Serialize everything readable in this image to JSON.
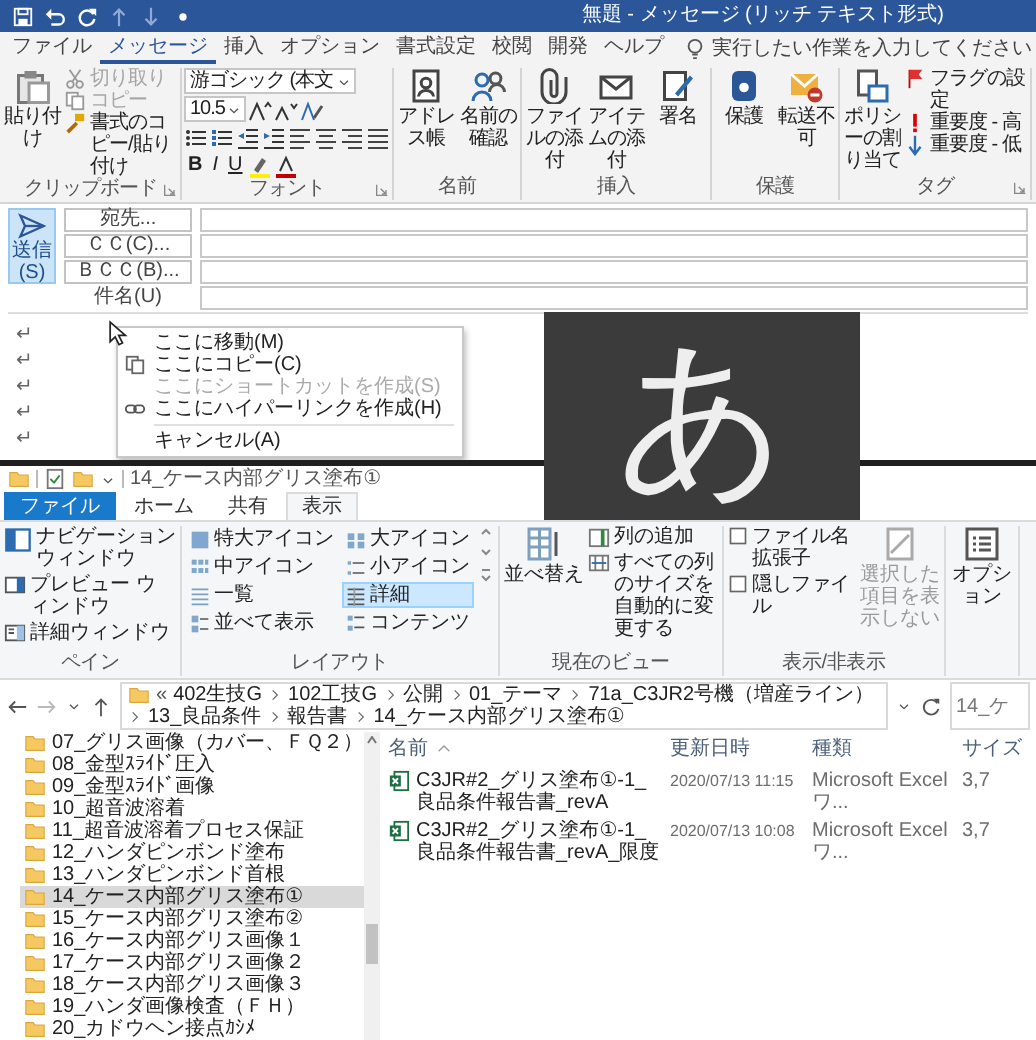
{
  "outlook": {
    "title": "無題 - メッセージ (リッチ テキスト形式)",
    "tabs": [
      {
        "label": "ファイル",
        "selected": false
      },
      {
        "label": "メッセージ",
        "selected": true
      },
      {
        "label": "挿入",
        "selected": false
      },
      {
        "label": "オプション",
        "selected": false
      },
      {
        "label": "書式設定",
        "selected": false
      },
      {
        "label": "校閲",
        "selected": false
      },
      {
        "label": "開発",
        "selected": false
      },
      {
        "label": "ヘルプ",
        "selected": false
      }
    ],
    "tell_me": {
      "placeholder": "実行したい作業を入力してください"
    },
    "ribbon_groups": [
      {
        "kind": "buttons",
        "label": "クリップボード",
        "launcher": true,
        "large": [
          {
            "label": "貼り付け",
            "disabled": false
          }
        ],
        "small": [
          {
            "label": "切り取り",
            "disabled": true
          },
          {
            "label": "コピー",
            "disabled": true
          },
          {
            "label": "書式のコピー/貼り付け",
            "disabled": false
          }
        ]
      },
      {
        "kind": "font",
        "label": "フォント",
        "launcher": true,
        "font_name": "游ゴシック (本文",
        "font_size": "10.5",
        "format_buttons": [
          "B",
          "I",
          "U"
        ]
      },
      {
        "kind": "buttons",
        "label": "名前",
        "launcher": false,
        "large": [
          {
            "label": "アドレス帳",
            "disabled": false
          },
          {
            "label": "名前の確認",
            "disabled": false
          }
        ]
      },
      {
        "kind": "buttons",
        "label": "挿入",
        "launcher": false,
        "large": [
          {
            "label": "ファイルの添付",
            "disabled": false
          },
          {
            "label": "アイテムの添付",
            "disabled": false
          },
          {
            "label": "署名",
            "disabled": false
          }
        ]
      },
      {
        "kind": "buttons",
        "label": "保護",
        "launcher": false,
        "large": [
          {
            "label": "保護",
            "disabled": false
          },
          {
            "label": "転送不可",
            "disabled": false
          }
        ]
      },
      {
        "kind": "buttons",
        "label": "タグ",
        "launcher": true,
        "large": [
          {
            "label": "ポリシーの割り当て",
            "disabled": false
          }
        ],
        "small": [
          {
            "label": "フラグの設定",
            "disabled": false
          },
          {
            "label": "重要度 - 高",
            "disabled": false
          },
          {
            "label": "重要度 - 低",
            "disabled": false
          }
        ]
      }
    ],
    "header": {
      "send_button": "送信 (S)",
      "recipient_buttons": [
        "宛先...",
        "ＣＣ(C)...",
        "ＢＣＣ(B)..."
      ],
      "subject_label": "件名(U)"
    },
    "body": {
      "paragraph_marks": [
        "↵",
        "↵",
        "↵",
        "↵",
        "↵"
      ]
    },
    "context_menu": [
      {
        "label": "ここに移動(M)",
        "disabled": false
      },
      {
        "label": "ここにコピー(C)",
        "disabled": false
      },
      {
        "label": "ここにショートカットを作成(S)",
        "disabled": true
      },
      {
        "label": "ここにハイパーリンクを作成(H)",
        "disabled": false
      },
      {
        "label": "キャンセル(A)",
        "disabled": false
      }
    ]
  },
  "ime_indicator": {
    "char": "あ"
  },
  "explorer": {
    "title": "14_ケース内部グリス塗布①",
    "tabs": [
      {
        "label": "ファイル",
        "kind": "menu",
        "selected": false
      },
      {
        "label": "ホーム",
        "kind": "tab",
        "selected": false
      },
      {
        "label": "共有",
        "kind": "tab",
        "selected": false
      },
      {
        "label": "表示",
        "kind": "tab",
        "selected": true
      }
    ],
    "ribbon": {
      "pane": {
        "label": "ペイン",
        "items": [
          "ナビゲーションウィンドウ",
          "プレビュー ウィンドウ",
          "詳細ウィンドウ"
        ]
      },
      "layout": {
        "label": "レイアウト",
        "options": [
          {
            "label": "特大アイコン",
            "selected": false
          },
          {
            "label": "大アイコン",
            "selected": false
          },
          {
            "label": "中アイコン",
            "selected": false
          },
          {
            "label": "小アイコン",
            "selected": false
          },
          {
            "label": "一覧",
            "selected": false
          },
          {
            "label": "詳細",
            "selected": true
          },
          {
            "label": "並べて表示",
            "selected": false
          },
          {
            "label": "コンテンツ",
            "selected": false
          }
        ]
      },
      "current_view": {
        "label": "現在のビュー",
        "sort": "並べ替え",
        "items": [
          "列の追加",
          "すべての列のサイズを自動的に変更する"
        ]
      },
      "show_hide": {
        "label": "表示/非表示",
        "checkboxes": [
          {
            "label": "ファイル名拡張子",
            "checked": false
          },
          {
            "label": "隠しファイル",
            "checked": false
          }
        ],
        "hide_selected": {
          "label": "選択した項目を表示しない",
          "disabled": true
        }
      },
      "options": {
        "label": "オプション"
      }
    },
    "address_bar": {
      "overflow": "«",
      "crumbs": [
        "402生技G",
        "102工技G",
        "公開",
        "01_テーマ",
        "71a_C3JR2号機（増産ライン）",
        "13_良品条件",
        "報告書",
        "14_ケース内部グリス塗布①"
      ]
    },
    "search": {
      "placeholder": "14_ケ"
    },
    "nav_tree": [
      {
        "label": "07_グリス画像（カバー、ＦＱ２）",
        "selected": false
      },
      {
        "label": "08_金型ｽﾗｲﾄﾞ圧入",
        "selected": false
      },
      {
        "label": "09_金型ｽﾗｲﾄﾞ画像",
        "selected": false
      },
      {
        "label": "10_超音波溶着",
        "selected": false
      },
      {
        "label": "11_超音波溶着プロセス保証",
        "selected": false
      },
      {
        "label": "12_ハンダピンボンド塗布",
        "selected": false
      },
      {
        "label": "13_ハンダピンボンド首根",
        "selected": false
      },
      {
        "label": "14_ケース内部グリス塗布①",
        "selected": true
      },
      {
        "label": "15_ケース内部グリス塗布②",
        "selected": false
      },
      {
        "label": "16_ケース内部グリス画像１",
        "selected": false
      },
      {
        "label": "17_ケース内部グリス画像２",
        "selected": false
      },
      {
        "label": "18_ケース内部グリス画像３",
        "selected": false
      },
      {
        "label": "19_ハンダ画像検査（ＦＨ）",
        "selected": false
      },
      {
        "label": "20_カドウヘン接点ｶｼﾒ",
        "selected": false
      }
    ],
    "file_list": {
      "columns": [
        "名前",
        "更新日時",
        "種類",
        "サイズ"
      ],
      "rows": [
        {
          "name": "C3JR#2_グリス塗布①-1_良品条件報告書_revA",
          "modified": "2020/07/13 11:15",
          "type": "Microsoft Excel ワ...",
          "size": "3,7"
        },
        {
          "name": "C3JR#2_グリス塗布①-1_良品条件報告書_revA_限度",
          "modified": "2020/07/13 10:08",
          "type": "Microsoft Excel ワ...",
          "size": "3,7"
        }
      ]
    }
  }
}
